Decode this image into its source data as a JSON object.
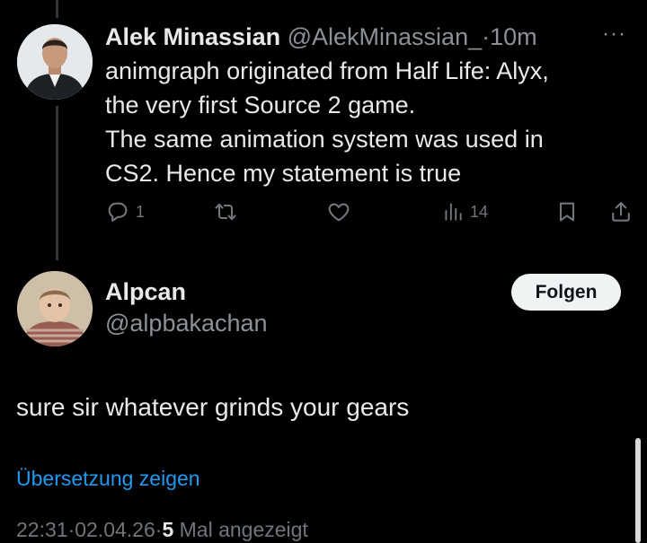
{
  "parent_tweet": {
    "author_name": "Alek Minassian",
    "handle": "@AlekMinassian_",
    "separator": "·",
    "time": "10m",
    "more_label": "···",
    "text_lines": [
      "animgraph originated from Half Life: Alyx,",
      "the very first Source 2 game.",
      "The same animation system was used in",
      "CS2. Hence my statement is true"
    ],
    "actions": {
      "reply_count": "1",
      "retweet_count": "",
      "like_count": "",
      "view_count": "14"
    }
  },
  "reply_tweet": {
    "author_name": "Alpcan",
    "handle": "@alpbakachan",
    "follow_label": "Folgen",
    "text": "sure sir whatever grinds your gears",
    "translate_label": "Übersetzung zeigen",
    "meta": {
      "time": "22:31",
      "separator": "·",
      "date": "02.04.26",
      "separator2": "·",
      "views_count": "5",
      "views_label": "Mal angezeigt"
    }
  },
  "colors": {
    "background": "#000000",
    "text": "#e7e9ea",
    "secondary": "#71767b",
    "link": "#1d9bf0"
  },
  "icons": [
    "reply-icon",
    "retweet-icon",
    "like-icon",
    "views-icon",
    "bookmark-icon",
    "share-icon",
    "more-icon"
  ]
}
